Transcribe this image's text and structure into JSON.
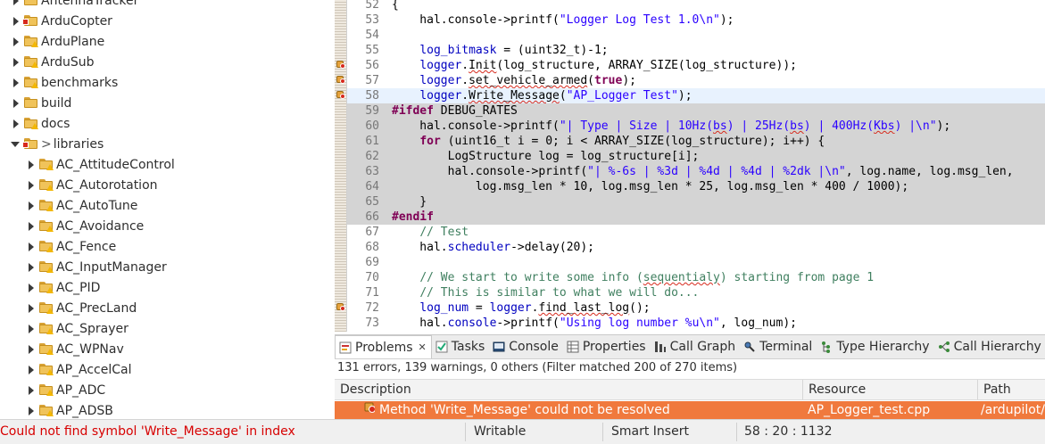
{
  "tree": {
    "items": [
      {
        "label": "AntennaTracker",
        "badge": "none"
      },
      {
        "label": "ArduCopter",
        "badge": "error"
      },
      {
        "label": "ArduPlane",
        "badge": "warn"
      },
      {
        "label": "ArduSub",
        "badge": "warn"
      },
      {
        "label": "benchmarks",
        "badge": "warn"
      },
      {
        "label": "build",
        "badge": "none"
      },
      {
        "label": "docs",
        "badge": "warn"
      },
      {
        "label": "libraries",
        "prefix": ">",
        "badge": "error",
        "expanded": true
      },
      {
        "label": "AC_AttitudeControl",
        "badge": "warn"
      },
      {
        "label": "AC_Autorotation",
        "badge": "warn"
      },
      {
        "label": "AC_AutoTune",
        "badge": "warn"
      },
      {
        "label": "AC_Avoidance",
        "badge": "warn"
      },
      {
        "label": "AC_Fence",
        "badge": "warn"
      },
      {
        "label": "AC_InputManager",
        "badge": "warn"
      },
      {
        "label": "AC_PID",
        "badge": "warn"
      },
      {
        "label": "AC_PrecLand",
        "badge": "warn"
      },
      {
        "label": "AC_Sprayer",
        "badge": "warn"
      },
      {
        "label": "AC_WPNav",
        "badge": "warn"
      },
      {
        "label": "AP_AccelCal",
        "badge": "warn"
      },
      {
        "label": "AP_ADC",
        "badge": "warn"
      },
      {
        "label": "AP_ADSB",
        "badge": "warn"
      }
    ]
  },
  "editor": {
    "lines": [
      {
        "n": "52",
        "html": "{",
        "hl": ""
      },
      {
        "n": "53",
        "html": "    hal.console-&gt;printf(<span class=\"str\">\"Logger Log Test 1.0\\n\"</span>);",
        "hl": ""
      },
      {
        "n": "54",
        "html": "",
        "hl": ""
      },
      {
        "n": "55",
        "html": "    <span class=\"var\">log_bitmask</span> = (uint32_t)-1;",
        "hl": ""
      },
      {
        "n": "56",
        "html": "    <span class=\"var\">logger</span>.<span class=\"sq\">Init</span>(log_structure, ARRAY_SIZE(log_structure));",
        "hl": "",
        "marker": true
      },
      {
        "n": "57",
        "html": "    <span class=\"var\">logger</span>.<span class=\"sq\">set_vehicle_armed</span>(<span class=\"kw\">true</span>);",
        "hl": "",
        "marker": true
      },
      {
        "n": "58",
        "html": "    <span class=\"var\">logger</span>.<span class=\"sq\">Write_Message</span>(<span class=\"str\">\"AP_Logger Test\"</span>);",
        "hl": "blue",
        "marker": true
      },
      {
        "n": "59",
        "html": "<span class=\"pre\">#ifdef</span> DEBUG_RATES",
        "hl": "grey"
      },
      {
        "n": "60",
        "html": "    hal.console-&gt;printf(<span class=\"str\">\"| Type | Size | 10Hz(<span class=\"sq\">bs</span>) | 25Hz(<span class=\"sq\">bs</span>) | 400Hz(<span class=\"sq\">Kbs</span>) |\\n\"</span>);",
        "hl": "grey"
      },
      {
        "n": "61",
        "html": "    <span class=\"kw\">for</span> (uint16_t i = 0; i &lt; ARRAY_SIZE(log_structure); i++) {",
        "hl": "grey"
      },
      {
        "n": "62",
        "html": "        LogStructure log = log_structure[i];",
        "hl": "grey"
      },
      {
        "n": "63",
        "html": "        hal.console-&gt;printf(<span class=\"str\">\"| %-6s | %3d | %4d | %4d | %2dk |\\n\"</span>, log.name, log.msg_len,",
        "hl": "grey"
      },
      {
        "n": "64",
        "html": "            log.msg_len * 10, log.msg_len * 25, log.msg_len * 400 / 1000);",
        "hl": "grey"
      },
      {
        "n": "65",
        "html": "    }",
        "hl": "grey"
      },
      {
        "n": "66",
        "html": "<span class=\"pre\">#endif</span>",
        "hl": "grey"
      },
      {
        "n": "67",
        "html": "    <span class=\"cmt\">// Test</span>",
        "hl": ""
      },
      {
        "n": "68",
        "html": "    hal.<span class=\"var\">scheduler</span>-&gt;delay(20);",
        "hl": ""
      },
      {
        "n": "69",
        "html": "",
        "hl": ""
      },
      {
        "n": "70",
        "html": "    <span class=\"cmt\">// We start to write some info (<span class=\"sq\">sequentialy</span>) starting from page 1</span>",
        "hl": ""
      },
      {
        "n": "71",
        "html": "    <span class=\"cmt\">// This is similar to what we will do...</span>",
        "hl": ""
      },
      {
        "n": "72",
        "html": "    <span class=\"var\">log_num</span> = <span class=\"var\">logger</span>.<span class=\"sq\">find_last_log</span>();",
        "hl": "",
        "marker": true
      },
      {
        "n": "73",
        "html": "    hal.<span class=\"var\">console</span>-&gt;printf(<span class=\"str\">\"Using log number %u\\n\"</span>, log_num);",
        "hl": ""
      }
    ]
  },
  "problems": {
    "tabs": [
      {
        "label": "Problems",
        "icon": "problems-icon",
        "active": true,
        "closable": true
      },
      {
        "label": "Tasks",
        "icon": "tasks-icon"
      },
      {
        "label": "Console",
        "icon": "console-icon"
      },
      {
        "label": "Properties",
        "icon": "properties-icon"
      },
      {
        "label": "Call Graph",
        "icon": "call-graph-icon"
      },
      {
        "label": "Terminal",
        "icon": "terminal-icon"
      },
      {
        "label": "Type Hierarchy",
        "icon": "type-hierarchy-icon"
      },
      {
        "label": "Call Hierarchy",
        "icon": "call-hierarchy-icon"
      }
    ],
    "summary": "131 errors, 139 warnings, 0 others (Filter matched 200 of 270 items)",
    "columns": {
      "description": "Description",
      "resource": "Resource",
      "path": "Path"
    },
    "row": {
      "description": "Method 'Write_Message' could not be resolved",
      "resource": "AP_Logger_test.cpp",
      "path": "/ardupilot/"
    }
  },
  "status": {
    "message": "Could not find symbol 'Write_Message' in index",
    "writable": "Writable",
    "insert_mode": "Smart Insert",
    "position": "58 : 20 : 1132"
  },
  "colors": {
    "error_row": "#f0793d",
    "status_error_text": "#d70000",
    "keyword": "#7f0055",
    "string": "#2a00ff",
    "comment": "#3f7f5f"
  }
}
